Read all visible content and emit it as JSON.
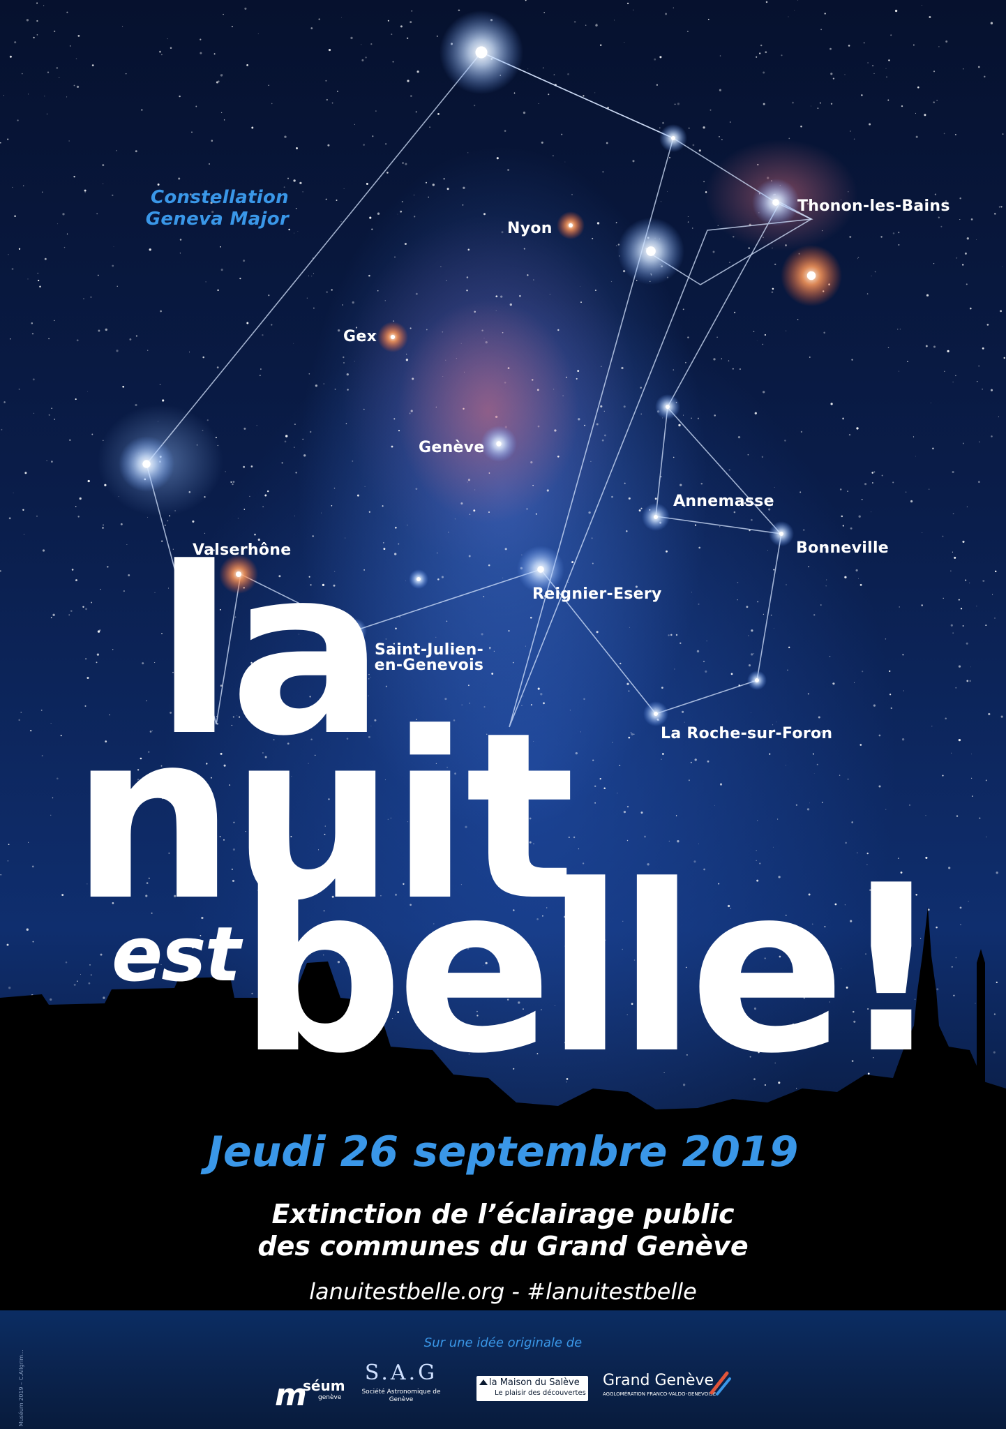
{
  "constellation_title": [
    "Constellation",
    "Geneva Major"
  ],
  "stars": [
    {
      "name": "Nyon"
    },
    {
      "name": "Thonon-les-Bains"
    },
    {
      "name": "Gex"
    },
    {
      "name": "Genève"
    },
    {
      "name": "Annemasse"
    },
    {
      "name": "Bonneville"
    },
    {
      "name": "Valserhône"
    },
    {
      "name": "Reignier-Esery"
    },
    {
      "name": "Saint-Julien-\nen-Genevois"
    },
    {
      "name": "La Roche-sur-Foron"
    }
  ],
  "headline": {
    "la": "la",
    "nuit": "nuit",
    "est": "est",
    "belle": "belle!"
  },
  "event_date": "Jeudi 26 septembre 2019",
  "description": [
    "Extinction de l’éclairage public",
    "des communes du Grand Genève"
  ],
  "website": "lanuitestbelle.org - #lanuitestbelle",
  "credit_intro": "Sur une idée originale de",
  "logos": [
    {
      "icon": "museum-geneve-logo",
      "text": "séum",
      "sub": "genève"
    },
    {
      "icon": "sag-logo",
      "text": "S.A.G",
      "sub": "Société Astronomique de Genève"
    },
    {
      "icon": "maison-du-saleve-logo",
      "text": "la Maison du Salève",
      "sub": "Le plaisir des découvertes"
    },
    {
      "icon": "grand-geneve-logo",
      "text": "Grand Genève",
      "sub": "AGGLOMÉRATION FRANCO-VALDO-GENEVOISE"
    }
  ],
  "side_credit": "© Muséum 2019 – C.Allgrim...",
  "colors": {
    "accent_blue": "#3a97e8",
    "white": "#ffffff",
    "sky_dark": "#030814"
  }
}
